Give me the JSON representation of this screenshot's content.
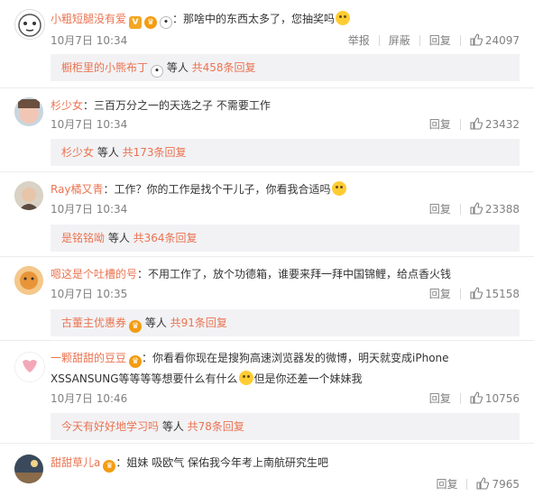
{
  "comments": [
    {
      "username": "小粗短腿没有爱",
      "text": "那啥中的东西太多了，您抽奖吗",
      "date": "10月7日 10:34",
      "actions": {
        "report": "举报",
        "block": "屏蔽",
        "reply": "回复",
        "likes": "24097"
      },
      "replies": {
        "who": "橱柜里的小熊布丁",
        "mid": " 等人 ",
        "count": "共458条回复"
      }
    },
    {
      "username": "杉少女",
      "text": "三百万分之一的天选之子 不需要工作",
      "date": "10月7日 10:34",
      "actions": {
        "reply": "回复",
        "likes": "23432"
      },
      "replies": {
        "who": "杉少女",
        "mid": " 等人 ",
        "count": "共173条回复"
      }
    },
    {
      "username": "Ray橘又青",
      "text": "工作？你的工作是找个干儿子，你看我合适吗",
      "date": "10月7日 10:34",
      "actions": {
        "reply": "回复",
        "likes": "23388"
      },
      "replies": {
        "who": "是铭铭呦",
        "mid": " 等人 ",
        "count": "共364条回复"
      }
    },
    {
      "username": "嗯这是个吐槽的号",
      "text": "不用工作了，放个功德箱，谁要来拜一拜中国锦鲤，给点香火钱",
      "date": "10月7日 10:35",
      "actions": {
        "reply": "回复",
        "likes": "15158"
      },
      "replies": {
        "who": "古董主优惠券",
        "mid": " 等人 ",
        "count": "共91条回复"
      }
    },
    {
      "username": "一颗甜甜的豆豆",
      "text": "你看看你现在是搜狗高速浏览器发的微博，明天就变成iPhone",
      "text2": "XSSANSUNG等等等等想要什么有什么",
      "text3": "但是你还差一个妹妹我",
      "date": "10月7日 10:46",
      "actions": {
        "reply": "回复",
        "likes": "10756"
      },
      "replies": {
        "who": "今天有好好地学习吗",
        "mid": " 等人 ",
        "count": "共78条回复"
      }
    },
    {
      "username": "甜甜草儿a",
      "text": "姐妹 吸欧气 保佑我今年考上南航研究生吧",
      "actions": {
        "reply": "回复",
        "likes": "7965"
      }
    }
  ],
  "colors": {
    "accent": "#eb7350",
    "muted": "#808080",
    "reply_bg": "#f2f2f5"
  }
}
